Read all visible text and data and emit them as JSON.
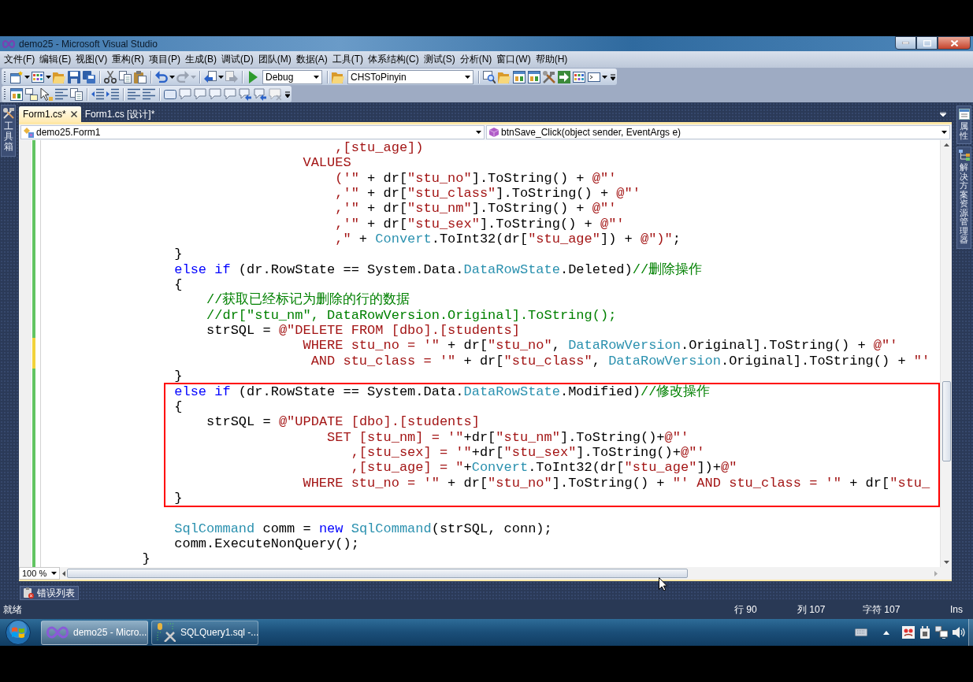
{
  "window": {
    "title": "demo25 - Microsoft Visual Studio"
  },
  "menu": [
    "文件(F)",
    "编辑(E)",
    "视图(V)",
    "重构(R)",
    "项目(P)",
    "生成(B)",
    "调试(D)",
    "团队(M)",
    "数据(A)",
    "工具(T)",
    "体系结构(C)",
    "测试(S)",
    "分析(N)",
    "窗口(W)",
    "帮助(H)"
  ],
  "toolbar": {
    "configuration": "Debug",
    "startup_project": "CHSToPinyin"
  },
  "left_panels": [
    "工具箱"
  ],
  "right_panels": [
    "属性",
    "解决方案资源管理器"
  ],
  "document_tabs": [
    {
      "label": "Form1.cs*",
      "selected": true
    },
    {
      "label": "Form1.cs [设计]*",
      "selected": false
    }
  ],
  "navigation": {
    "type": "demo25.Form1",
    "member": "btnSave_Click(object sender, EventArgs e)"
  },
  "code": {
    "blocks": [
      {
        "highlighted": false,
        "lines": [
          {
            "kind": "code",
            "unsaved": false,
            "tokens": [
              {
                "kind": "string",
                "text": "                                    ,[stu_age])"
              }
            ]
          },
          {
            "kind": "code",
            "unsaved": false,
            "tokens": [
              {
                "kind": "string",
                "text": "                                VALUES"
              }
            ]
          },
          {
            "kind": "code",
            "unsaved": false,
            "tokens": [
              {
                "kind": "string",
                "text": "                                    ('\""
              },
              {
                "kind": "plain",
                "text": " + dr["
              },
              {
                "kind": "string",
                "text": "\"stu_no\""
              },
              {
                "kind": "plain",
                "text": "].ToString() + "
              },
              {
                "kind": "string",
                "text": "@\"'"
              }
            ]
          },
          {
            "kind": "code",
            "unsaved": false,
            "tokens": [
              {
                "kind": "string",
                "text": "                                    ,'\""
              },
              {
                "kind": "plain",
                "text": " + dr["
              },
              {
                "kind": "string",
                "text": "\"stu_class\""
              },
              {
                "kind": "plain",
                "text": "].ToString() + "
              },
              {
                "kind": "string",
                "text": "@\"'"
              }
            ]
          },
          {
            "kind": "code",
            "unsaved": false,
            "tokens": [
              {
                "kind": "string",
                "text": "                                    ,'\""
              },
              {
                "kind": "plain",
                "text": " + dr["
              },
              {
                "kind": "string",
                "text": "\"stu_nm\""
              },
              {
                "kind": "plain",
                "text": "].ToString() + "
              },
              {
                "kind": "string",
                "text": "@\"'"
              }
            ]
          },
          {
            "kind": "code",
            "unsaved": false,
            "tokens": [
              {
                "kind": "string",
                "text": "                                    ,'\""
              },
              {
                "kind": "plain",
                "text": " + dr["
              },
              {
                "kind": "string",
                "text": "\"stu_sex\""
              },
              {
                "kind": "plain",
                "text": "].ToString() + "
              },
              {
                "kind": "string",
                "text": "@\"'"
              }
            ]
          },
          {
            "kind": "code",
            "unsaved": false,
            "tokens": [
              {
                "kind": "string",
                "text": "                                    ,\""
              },
              {
                "kind": "plain",
                "text": " + "
              },
              {
                "kind": "type",
                "text": "Convert"
              },
              {
                "kind": "plain",
                "text": ".ToInt32(dr["
              },
              {
                "kind": "string",
                "text": "\"stu_age\""
              },
              {
                "kind": "plain",
                "text": "]) + "
              },
              {
                "kind": "string",
                "text": "@\")\""
              },
              {
                "kind": "plain",
                "text": ";"
              }
            ]
          },
          {
            "kind": "code",
            "unsaved": false,
            "tokens": [
              {
                "kind": "plain",
                "text": "                }"
              }
            ]
          },
          {
            "kind": "code",
            "unsaved": false,
            "tokens": [
              {
                "kind": "keyword",
                "text": "                else if"
              },
              {
                "kind": "plain",
                "text": " (dr.RowState == System.Data."
              },
              {
                "kind": "type",
                "text": "DataRowState"
              },
              {
                "kind": "plain",
                "text": ".Deleted)"
              },
              {
                "kind": "comment",
                "text": "//删除操作"
              }
            ]
          },
          {
            "kind": "code",
            "unsaved": false,
            "tokens": [
              {
                "kind": "plain",
                "text": "                {"
              }
            ]
          },
          {
            "kind": "code",
            "unsaved": false,
            "tokens": [
              {
                "kind": "comment",
                "text": "                    //获取已经标记为删除的行的数据"
              }
            ]
          },
          {
            "kind": "code",
            "unsaved": false,
            "tokens": [
              {
                "kind": "comment",
                "text": "                    //dr[\"stu_nm\", DataRowVersion.Original].ToString();"
              }
            ]
          },
          {
            "kind": "code",
            "unsaved": false,
            "tokens": [
              {
                "kind": "plain",
                "text": "                    strSQL = "
              },
              {
                "kind": "string",
                "text": "@\"DELETE FROM [dbo].[students]"
              }
            ]
          },
          {
            "kind": "code",
            "unsaved": true,
            "tokens": [
              {
                "kind": "string",
                "text": "                                WHERE stu_no = '\""
              },
              {
                "kind": "plain",
                "text": " + dr["
              },
              {
                "kind": "string",
                "text": "\"stu_no\""
              },
              {
                "kind": "plain",
                "text": ", "
              },
              {
                "kind": "type",
                "text": "DataRowVersion"
              },
              {
                "kind": "plain",
                "text": ".Original].ToString() + "
              },
              {
                "kind": "string",
                "text": "@\"'"
              }
            ]
          },
          {
            "kind": "code",
            "unsaved": true,
            "tokens": [
              {
                "kind": "string",
                "text": "                                 AND stu_class = '\""
              },
              {
                "kind": "plain",
                "text": " + dr["
              },
              {
                "kind": "string",
                "text": "\"stu_class\""
              },
              {
                "kind": "plain",
                "text": ", "
              },
              {
                "kind": "type",
                "text": "DataRowVersion"
              },
              {
                "kind": "plain",
                "text": ".Original].ToString() + "
              },
              {
                "kind": "string",
                "text": "\"'"
              }
            ]
          },
          {
            "kind": "code",
            "unsaved": false,
            "tokens": [
              {
                "kind": "plain",
                "text": "                }"
              }
            ]
          }
        ]
      },
      {
        "highlighted": true,
        "lines": [
          {
            "kind": "code",
            "unsaved": false,
            "tokens": [
              {
                "kind": "keyword",
                "text": "                else if"
              },
              {
                "kind": "plain",
                "text": " (dr.RowState == System.Data."
              },
              {
                "kind": "type",
                "text": "DataRowState"
              },
              {
                "kind": "plain",
                "text": ".Modified)"
              },
              {
                "kind": "comment",
                "text": "//修改操作"
              }
            ]
          },
          {
            "kind": "code",
            "unsaved": false,
            "tokens": [
              {
                "kind": "plain",
                "text": "                {"
              }
            ]
          },
          {
            "kind": "code",
            "unsaved": false,
            "tokens": [
              {
                "kind": "plain",
                "text": "                    strSQL = "
              },
              {
                "kind": "string",
                "text": "@\"UPDATE [dbo].[students]"
              }
            ]
          },
          {
            "kind": "code",
            "unsaved": false,
            "tokens": [
              {
                "kind": "string",
                "text": "                                   SET [stu_nm] = '\""
              },
              {
                "kind": "plain",
                "text": "+dr["
              },
              {
                "kind": "string",
                "text": "\"stu_nm\""
              },
              {
                "kind": "plain",
                "text": "].ToString()+"
              },
              {
                "kind": "string",
                "text": "@\"'"
              }
            ]
          },
          {
            "kind": "code",
            "unsaved": false,
            "tokens": [
              {
                "kind": "string",
                "text": "                                      ,[stu_sex] = '\""
              },
              {
                "kind": "plain",
                "text": "+dr["
              },
              {
                "kind": "string",
                "text": "\"stu_sex\""
              },
              {
                "kind": "plain",
                "text": "].ToString()+"
              },
              {
                "kind": "string",
                "text": "@\"'"
              }
            ]
          },
          {
            "kind": "code",
            "unsaved": false,
            "tokens": [
              {
                "kind": "string",
                "text": "                                      ,[stu_age] = \""
              },
              {
                "kind": "plain",
                "text": "+"
              },
              {
                "kind": "type",
                "text": "Convert"
              },
              {
                "kind": "plain",
                "text": ".ToInt32(dr["
              },
              {
                "kind": "string",
                "text": "\"stu_age\""
              },
              {
                "kind": "plain",
                "text": "])+"
              },
              {
                "kind": "string",
                "text": "@\""
              }
            ]
          },
          {
            "kind": "code",
            "unsaved": false,
            "tokens": [
              {
                "kind": "string",
                "text": "                                WHERE stu_no = '\""
              },
              {
                "kind": "plain",
                "text": " + dr["
              },
              {
                "kind": "string",
                "text": "\"stu_no\""
              },
              {
                "kind": "plain",
                "text": "].ToString() + "
              },
              {
                "kind": "string",
                "text": "\"' AND stu_class = '\""
              },
              {
                "kind": "plain",
                "text": " + dr["
              },
              {
                "kind": "string",
                "text": "\"stu_"
              }
            ]
          },
          {
            "kind": "code",
            "unsaved": false,
            "tokens": [
              {
                "kind": "plain",
                "text": "                }"
              }
            ]
          }
        ]
      },
      {
        "highlighted": false,
        "lines": [
          {
            "kind": "blank",
            "unsaved": false
          },
          {
            "kind": "code",
            "unsaved": false,
            "tokens": [
              {
                "kind": "type",
                "text": "                SqlCommand"
              },
              {
                "kind": "plain",
                "text": " comm = "
              },
              {
                "kind": "keyword",
                "text": "new"
              },
              {
                "kind": "type",
                "text": " SqlCommand"
              },
              {
                "kind": "plain",
                "text": "(strSQL, conn);"
              }
            ]
          },
          {
            "kind": "code",
            "unsaved": false,
            "tokens": [
              {
                "kind": "plain",
                "text": "                comm.ExecuteNonQuery();"
              }
            ]
          },
          {
            "kind": "code",
            "unsaved": false,
            "tokens": [
              {
                "kind": "plain",
                "text": "            }"
              }
            ]
          }
        ]
      }
    ]
  },
  "zoom": "100 %",
  "bottom_panels": [
    "错误列表"
  ],
  "status_bar": {
    "message": "就绪",
    "line": "行 90",
    "column": "列 107",
    "character": "字符 107",
    "mode": "Ins"
  },
  "taskbar": {
    "buttons": [
      {
        "label": "demo25 - Micro...",
        "selected": true
      },
      {
        "label": "SQLQuery1.sql -...",
        "selected": false
      }
    ]
  }
}
